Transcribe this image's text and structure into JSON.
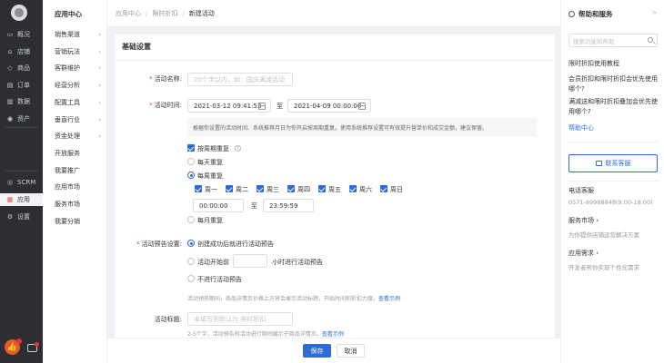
{
  "sidebar": {
    "items": [
      {
        "label": "概况",
        "icon": "monitor-icon",
        "glyph": "▭"
      },
      {
        "label": "店铺",
        "icon": "store-icon",
        "glyph": "⌂"
      },
      {
        "label": "商品",
        "icon": "tag-icon",
        "glyph": "◇"
      },
      {
        "label": "订单",
        "icon": "order-icon",
        "glyph": "▤"
      },
      {
        "label": "数据",
        "icon": "chart-icon",
        "glyph": "▥"
      },
      {
        "label": "资产",
        "icon": "coin-icon",
        "glyph": "◉"
      }
    ],
    "bottom_items": [
      {
        "label": "SCRM",
        "icon": "scrm-icon",
        "glyph": "◎"
      },
      {
        "label": "应用",
        "icon": "apps-icon",
        "glyph": "▦"
      },
      {
        "label": "设置",
        "icon": "gear-icon",
        "glyph": "⚙"
      }
    ],
    "fab_glyph": "👍"
  },
  "subnav": {
    "title": "应用中心",
    "items": [
      {
        "label": "销售渠道",
        "arrow": "›"
      },
      {
        "label": "营销玩法",
        "arrow": "›"
      },
      {
        "label": "客群维护",
        "arrow": "›"
      },
      {
        "label": "经营分析",
        "arrow": "›"
      },
      {
        "label": "配置工具",
        "arrow": "›"
      },
      {
        "label": "垂直行业",
        "arrow": "›"
      },
      {
        "label": "资金处理",
        "arrow": "›"
      },
      {
        "label": "开放服务",
        "arrow": ""
      },
      {
        "label": "我要推广",
        "arrow": ""
      },
      {
        "label": "应用市场",
        "arrow": ""
      },
      {
        "label": "服务市场",
        "arrow": ""
      },
      {
        "label": "我要分销",
        "arrow": ""
      }
    ]
  },
  "breadcrumb": {
    "items": [
      "应用中心",
      "限时折扣",
      "新建活动"
    ],
    "sep": "/"
  },
  "form": {
    "section_title": "基础设置",
    "name_label": "活动名称:",
    "name_placeholder": "20个字以内，如：国庆满减活动",
    "time_label": "活动时间:",
    "start_time": "2021-03-12 09:41:53",
    "to_text": "至",
    "end_time": "2021-04-09 00:00:00",
    "time_note": "根据你设置的活动时间、系统推荐月日为你开启按周期重复。使用系统推荐设置可有效提升营单价和成交金额，建议保留。",
    "repeat_label": "按周期重复",
    "help_glyph": "?",
    "daily_label": "每天重复",
    "weekly_label": "每周重复",
    "weekdays": [
      "周一",
      "周二",
      "周三",
      "周四",
      "周五",
      "周六",
      "周日"
    ],
    "range_start": "00:00:00",
    "range_to": "至",
    "range_end": "23:59:59",
    "monthly_label": "每月重复",
    "preview_label": "活动预告设置:",
    "preview_opt1": "创建成功后就进行活动预告",
    "preview_opt2_pre": "活动开始前",
    "preview_opt2_post": "小时进行活动预告",
    "preview_opt3": "不进行活动预告",
    "preview_hint": "活动预热期间，商品详情页价格上方将会展示活动标题，开始时间和折扣力度。",
    "preview_hint_link": "查看示例",
    "tag_label": "活动标题:",
    "tag_placeholder": "未填写则默认为 限时折扣",
    "tag_hint": "2-5个字，活动预告和活动进行期间展示于商品详情页。",
    "tag_hint_link": "查看示例"
  },
  "footer": {
    "save_label": "保存",
    "cancel_label": "取消"
  },
  "help_panel": {
    "title": "帮助和服务",
    "collapse_glyph": "»",
    "search_placeholder": "搜索功能和帮助",
    "q1": "限时折扣使用教程",
    "q2": "会员折扣和限时折扣会优先使用哪个?",
    "q3": "满减送和限时折扣叠加会优先使用哪个?",
    "help_center": "帮助中心",
    "contact_button": "联系客服",
    "phone_title": "电话客服",
    "phone": "0571-89988848(9:00-18:00)",
    "service_title": "服务市场 ›",
    "service_sub": "为你提供店铺运营解决方案",
    "app_title": "应用需求 ›",
    "app_sub": "开发者帮你实现个性化需求"
  }
}
